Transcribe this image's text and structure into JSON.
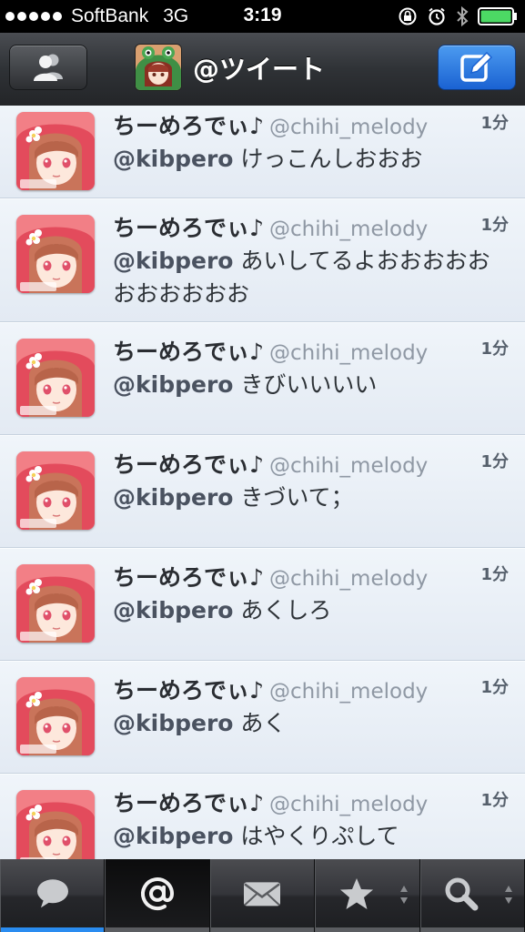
{
  "status_bar": {
    "carrier": "SoftBank",
    "network": "3G",
    "time": "3:19"
  },
  "nav": {
    "title": "@ツイート",
    "left_button_icon": "accounts-icon",
    "right_button_icon": "compose-icon"
  },
  "tweets": [
    {
      "name": "ちーめろでぃ♪",
      "handle": "@chihi_melody",
      "time": "1分",
      "mention": "@kibpero",
      "text": "けっこんしおおお"
    },
    {
      "name": "ちーめろでぃ♪",
      "handle": "@chihi_melody",
      "time": "1分",
      "mention": "@kibpero",
      "text": "あいしてるよおおおおおおおおおおお"
    },
    {
      "name": "ちーめろでぃ♪",
      "handle": "@chihi_melody",
      "time": "1分",
      "mention": "@kibpero",
      "text": "きびいいいい"
    },
    {
      "name": "ちーめろでぃ♪",
      "handle": "@chihi_melody",
      "time": "1分",
      "mention": "@kibpero",
      "text": "きづいて；"
    },
    {
      "name": "ちーめろでぃ♪",
      "handle": "@chihi_melody",
      "time": "1分",
      "mention": "@kibpero",
      "text": "あくしろ"
    },
    {
      "name": "ちーめろでぃ♪",
      "handle": "@chihi_melody",
      "time": "1分",
      "mention": "@kibpero",
      "text": "あく"
    },
    {
      "name": "ちーめろでぃ♪",
      "handle": "@chihi_melody",
      "time": "1分",
      "mention": "@kibpero",
      "text": "はやくりぷして"
    }
  ],
  "tabs": [
    {
      "icon": "speech-bubble-icon",
      "active": false
    },
    {
      "icon": "at-sign-icon",
      "active": true
    },
    {
      "icon": "envelope-icon",
      "active": false
    },
    {
      "icon": "star-icon",
      "active": false
    },
    {
      "icon": "magnifier-icon",
      "active": false
    }
  ],
  "colors": {
    "accent_blue": "#2a8cf0",
    "navbar": "#2f3236",
    "timeline_bg": "#e7eef6"
  }
}
